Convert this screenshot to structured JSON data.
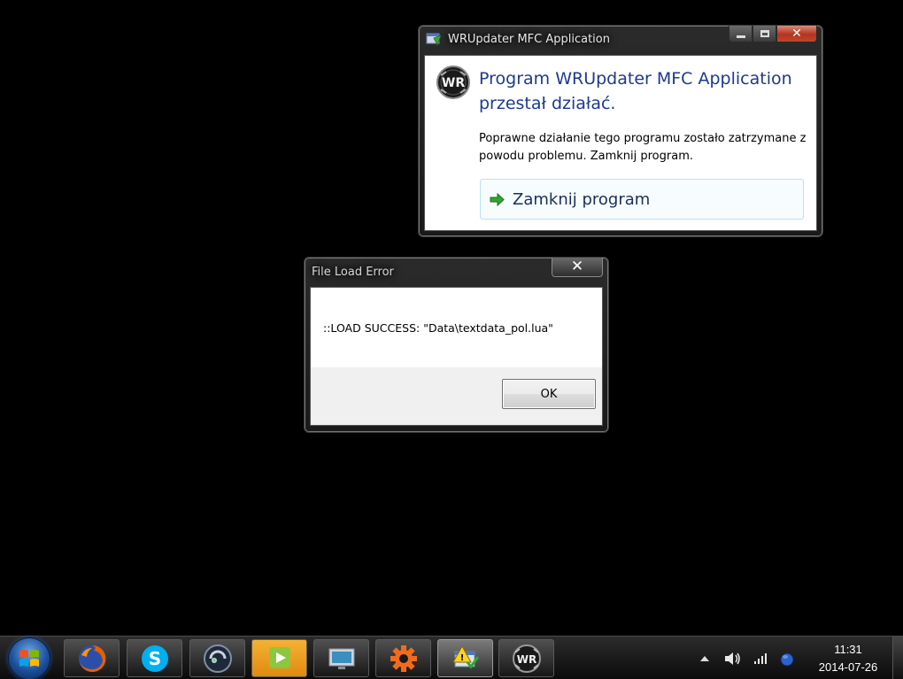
{
  "crash_dialog": {
    "title": "WRUpdater MFC Application",
    "heading": "Program WRUpdater MFC Application przestał działać.",
    "description": "Poprawne działanie tego programu zostało zatrzymane z powodu problemu. Zamknij program.",
    "close_program_label": "Zamknij program",
    "app_icon_text": "WR"
  },
  "error_dialog": {
    "title": "File Load Error",
    "message": "::LOAD SUCCESS: \"Data\\textdata_pol.lua\"",
    "ok_label": "OK"
  },
  "taskbar": {
    "buttons": [
      {
        "name": "Firefox",
        "icon": "firefox-icon"
      },
      {
        "name": "Skype",
        "icon": "skype-icon"
      },
      {
        "name": "TeamSpeak",
        "icon": "teamspeak-icon"
      },
      {
        "name": "Media player",
        "icon": "play-icon"
      },
      {
        "name": "Monitor",
        "icon": "monitor-icon"
      },
      {
        "name": "Settings",
        "icon": "gear-icon"
      },
      {
        "name": "Action Center",
        "icon": "action-center-icon"
      },
      {
        "name": "WRUpdater",
        "icon": "wr-icon",
        "label": "WR"
      }
    ],
    "clock": {
      "time": "11:31",
      "date": "2014-07-26"
    }
  },
  "colors": {
    "desktop_bg": "#000000",
    "heading_blue": "#1c3a8e",
    "close_button_red": "#b3341e",
    "arrow_green": "#2fa82f"
  }
}
